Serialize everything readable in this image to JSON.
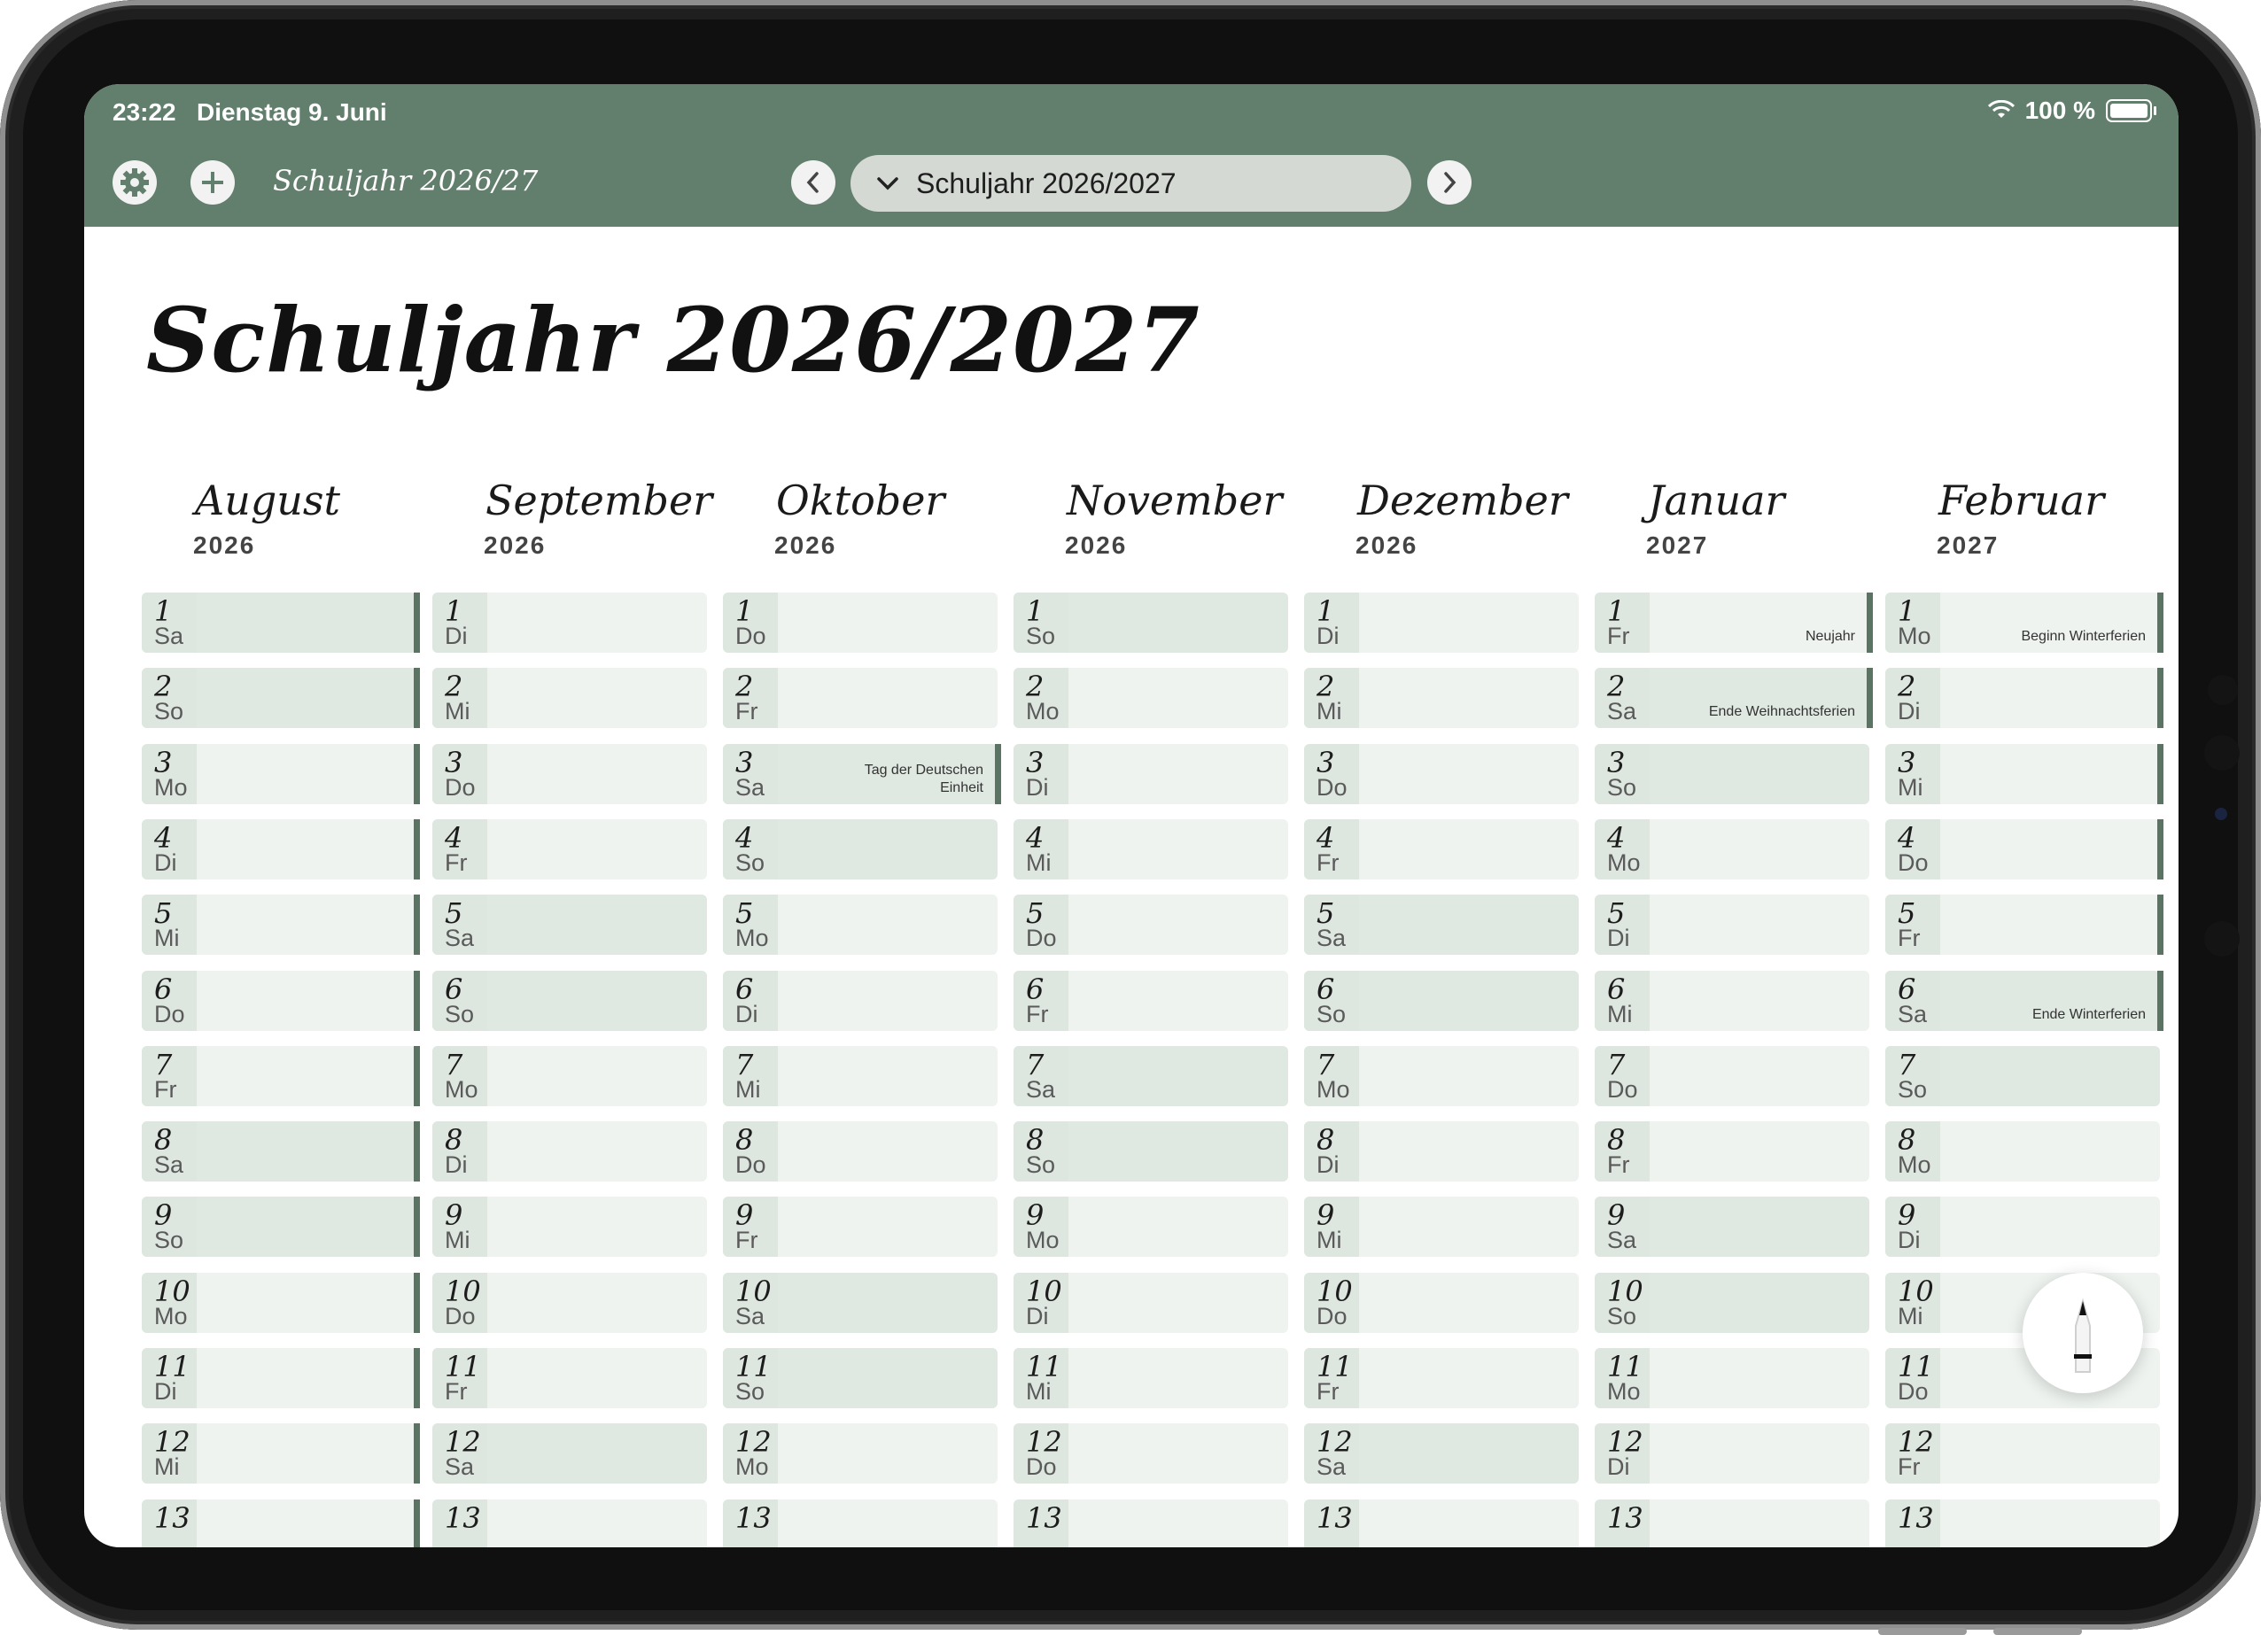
{
  "status_bar": {
    "time": "23:22",
    "date": "Dienstag 9. Juni",
    "battery": "100 %"
  },
  "toolbar": {
    "doc_title": "Schuljahr 2026/27",
    "selected_year": "Schuljahr 2026/2027"
  },
  "page": {
    "title": "Schuljahr 2026/2027"
  },
  "icons": [
    "gear-icon",
    "plus-icon",
    "chevron-left-icon",
    "chevron-down-icon",
    "chevron-right-icon",
    "wifi-icon",
    "battery-icon",
    "pencil-icon"
  ],
  "colors": {
    "header": "#627e6c",
    "weekday_cell": "#eef3ef",
    "weekend_cell": "#dfe8e1",
    "holiday_bar": "#5a7362"
  },
  "months": [
    {
      "name": "August",
      "year": "2026",
      "days": [
        {
          "d": "1",
          "w": "Sa"
        },
        {
          "d": "2",
          "w": "So"
        },
        {
          "d": "3",
          "w": "Mo"
        },
        {
          "d": "4",
          "w": "Di"
        },
        {
          "d": "5",
          "w": "Mi"
        },
        {
          "d": "6",
          "w": "Do"
        },
        {
          "d": "7",
          "w": "Fr"
        },
        {
          "d": "8",
          "w": "Sa"
        },
        {
          "d": "9",
          "w": "So"
        },
        {
          "d": "10",
          "w": "Mo"
        },
        {
          "d": "11",
          "w": "Di"
        },
        {
          "d": "12",
          "w": "Mi"
        },
        {
          "d": "13",
          "w": ""
        }
      ]
    },
    {
      "name": "September",
      "year": "2026",
      "days": [
        {
          "d": "1",
          "w": "Di"
        },
        {
          "d": "2",
          "w": "Mi"
        },
        {
          "d": "3",
          "w": "Do"
        },
        {
          "d": "4",
          "w": "Fr"
        },
        {
          "d": "5",
          "w": "Sa"
        },
        {
          "d": "6",
          "w": "So"
        },
        {
          "d": "7",
          "w": "Mo"
        },
        {
          "d": "8",
          "w": "Di"
        },
        {
          "d": "9",
          "w": "Mi"
        },
        {
          "d": "10",
          "w": "Do"
        },
        {
          "d": "11",
          "w": "Fr"
        },
        {
          "d": "12",
          "w": "Sa"
        },
        {
          "d": "13",
          "w": ""
        }
      ]
    },
    {
      "name": "Oktober",
      "year": "2026",
      "days": [
        {
          "d": "1",
          "w": "Do"
        },
        {
          "d": "2",
          "w": "Fr"
        },
        {
          "d": "3",
          "w": "Sa",
          "event": "Tag der Deutschen Einheit"
        },
        {
          "d": "4",
          "w": "So"
        },
        {
          "d": "5",
          "w": "Mo"
        },
        {
          "d": "6",
          "w": "Di"
        },
        {
          "d": "7",
          "w": "Mi"
        },
        {
          "d": "8",
          "w": "Do"
        },
        {
          "d": "9",
          "w": "Fr"
        },
        {
          "d": "10",
          "w": "Sa"
        },
        {
          "d": "11",
          "w": "So"
        },
        {
          "d": "12",
          "w": "Mo"
        },
        {
          "d": "13",
          "w": ""
        }
      ]
    },
    {
      "name": "November",
      "year": "2026",
      "days": [
        {
          "d": "1",
          "w": "So"
        },
        {
          "d": "2",
          "w": "Mo"
        },
        {
          "d": "3",
          "w": "Di"
        },
        {
          "d": "4",
          "w": "Mi"
        },
        {
          "d": "5",
          "w": "Do"
        },
        {
          "d": "6",
          "w": "Fr"
        },
        {
          "d": "7",
          "w": "Sa"
        },
        {
          "d": "8",
          "w": "So"
        },
        {
          "d": "9",
          "w": "Mo"
        },
        {
          "d": "10",
          "w": "Di"
        },
        {
          "d": "11",
          "w": "Mi"
        },
        {
          "d": "12",
          "w": "Do"
        },
        {
          "d": "13",
          "w": ""
        }
      ]
    },
    {
      "name": "Dezember",
      "year": "2026",
      "days": [
        {
          "d": "1",
          "w": "Di"
        },
        {
          "d": "2",
          "w": "Mi"
        },
        {
          "d": "3",
          "w": "Do"
        },
        {
          "d": "4",
          "w": "Fr"
        },
        {
          "d": "5",
          "w": "Sa"
        },
        {
          "d": "6",
          "w": "So"
        },
        {
          "d": "7",
          "w": "Mo"
        },
        {
          "d": "8",
          "w": "Di"
        },
        {
          "d": "9",
          "w": "Mi"
        },
        {
          "d": "10",
          "w": "Do"
        },
        {
          "d": "11",
          "w": "Fr"
        },
        {
          "d": "12",
          "w": "Sa"
        },
        {
          "d": "13",
          "w": ""
        }
      ]
    },
    {
      "name": "Januar",
      "year": "2027",
      "days": [
        {
          "d": "1",
          "w": "Fr",
          "event": "Neujahr"
        },
        {
          "d": "2",
          "w": "Sa",
          "event": "Ende Weihnachtsferien"
        },
        {
          "d": "3",
          "w": "So"
        },
        {
          "d": "4",
          "w": "Mo"
        },
        {
          "d": "5",
          "w": "Di"
        },
        {
          "d": "6",
          "w": "Mi"
        },
        {
          "d": "7",
          "w": "Do"
        },
        {
          "d": "8",
          "w": "Fr"
        },
        {
          "d": "9",
          "w": "Sa"
        },
        {
          "d": "10",
          "w": "So"
        },
        {
          "d": "11",
          "w": "Mo"
        },
        {
          "d": "12",
          "w": "Di"
        },
        {
          "d": "13",
          "w": ""
        }
      ]
    },
    {
      "name": "Februar",
      "year": "2027",
      "days": [
        {
          "d": "1",
          "w": "Mo",
          "event": "Beginn Winterferien"
        },
        {
          "d": "2",
          "w": "Di"
        },
        {
          "d": "3",
          "w": "Mi"
        },
        {
          "d": "4",
          "w": "Do"
        },
        {
          "d": "5",
          "w": "Fr"
        },
        {
          "d": "6",
          "w": "Sa",
          "event": "Ende Winterferien"
        },
        {
          "d": "7",
          "w": "So"
        },
        {
          "d": "8",
          "w": "Mo"
        },
        {
          "d": "9",
          "w": "Di"
        },
        {
          "d": "10",
          "w": "Mi"
        },
        {
          "d": "11",
          "w": "Do"
        },
        {
          "d": "12",
          "w": "Fr"
        },
        {
          "d": "13",
          "w": ""
        }
      ]
    }
  ],
  "holiday_bars": {
    "August": [
      1,
      2,
      3,
      4,
      5,
      6,
      7,
      8,
      9,
      10,
      11,
      12,
      13
    ],
    "Oktober": [
      3
    ],
    "Januar": [
      1,
      2
    ],
    "Februar": [
      1,
      2,
      3,
      4,
      5,
      6
    ]
  }
}
